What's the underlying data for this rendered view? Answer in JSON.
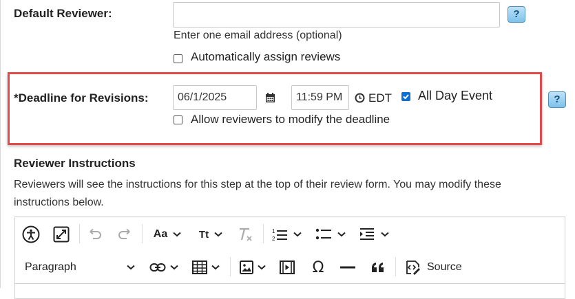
{
  "reviewer": {
    "label": "Default Reviewer:",
    "email_value": "",
    "email_hint": "Enter one email address (optional)",
    "auto_assign_label": "Automatically assign reviews",
    "auto_assign_checked": false,
    "help": "?"
  },
  "deadline": {
    "label": "*Deadline for Revisions:",
    "date_value": "06/1/2025",
    "time_value": "11:59 PM",
    "timezone": "EDT",
    "all_day_label": "All Day Event",
    "all_day_checked": true,
    "allow_modify_label": "Allow reviewers to modify the deadline",
    "allow_modify_checked": false,
    "help": "?"
  },
  "instructions": {
    "heading": "Reviewer Instructions",
    "description": "Reviewers will see the instructions for this step at the top of their review form. You may modify these instructions below."
  },
  "editor_toolbar": {
    "row1": [
      "accessibility-icon",
      "fullscreen-icon",
      "undo-icon",
      "redo-icon",
      "font-family-icon",
      "font-size-icon",
      "remove-format-icon",
      "numbered-list-icon",
      "bulleted-list-icon",
      "indent-icon"
    ],
    "font_family_glyph": "Aa",
    "font_size_glyph": "Tt",
    "paragraph_label": "Paragraph",
    "source_label": "Source",
    "row2": [
      "link-icon",
      "table-icon",
      "image-icon",
      "media-icon",
      "special-char-icon",
      "horizontal-line-icon",
      "blockquote-icon",
      "source-icon"
    ]
  },
  "colors": {
    "highlight": "#e04a4a",
    "checkbox_checked": "#0b6fd6",
    "help_button": "#7ec2ea"
  }
}
